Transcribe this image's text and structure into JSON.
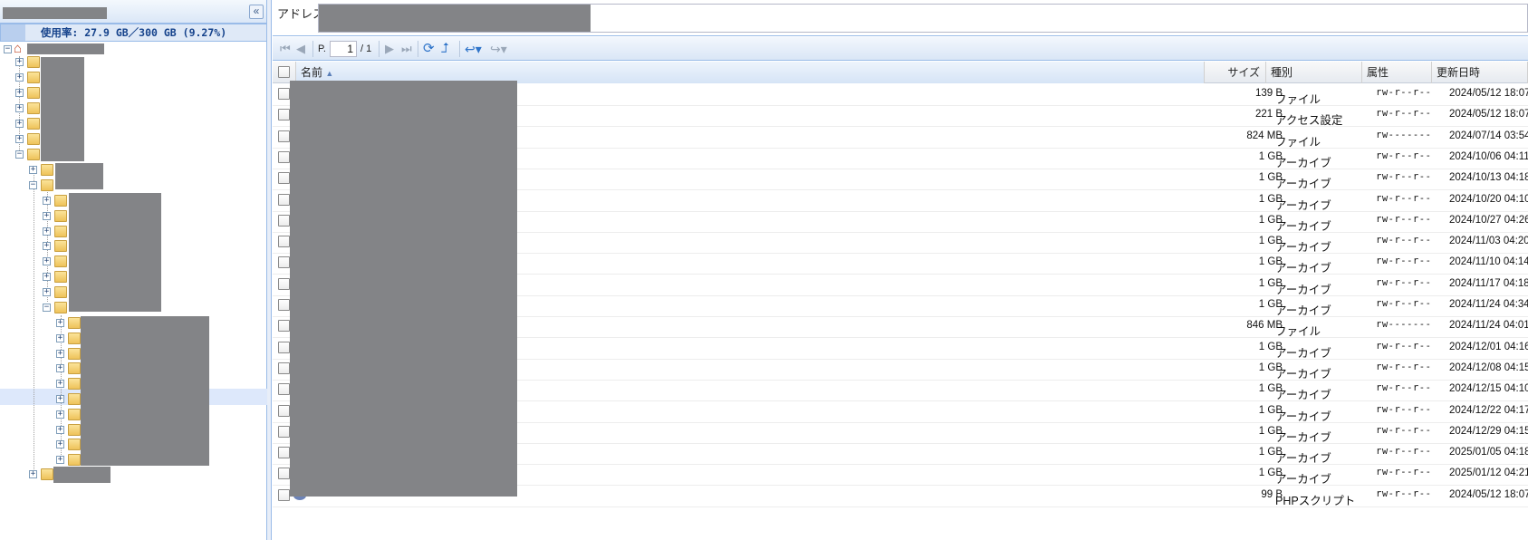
{
  "left_panel": {
    "collapse_label": "«",
    "usage_text": "使用率: 27.9 GB／300 GB (9.27%)",
    "usage_fraction": 0.0927
  },
  "address": {
    "label": "アドレス:"
  },
  "toolbar": {
    "page_prefix": "P.",
    "page_value": "1",
    "page_total": "/ 1"
  },
  "grid": {
    "headers": {
      "name": "名前",
      "size": "サイズ",
      "type": "種別",
      "attr": "属性",
      "date": "更新日時"
    },
    "rows": [
      {
        "icon": "file",
        "size": "139 B",
        "type": "ファイル",
        "attr": "rw-r--r--",
        "date": "2024/05/12 18:07"
      },
      {
        "icon": "htaccess",
        "size": "221 B",
        "type": "アクセス設定",
        "attr": "rw-r--r--",
        "date": "2024/05/12 18:07"
      },
      {
        "icon": "file",
        "size": "824 MB",
        "type": "ファイル",
        "attr": "rw-------",
        "date": "2024/07/14 03:54"
      },
      {
        "icon": "archive",
        "size": "1 GB",
        "type": "アーカイブ",
        "attr": "rw-r--r--",
        "date": "2024/10/06 04:11"
      },
      {
        "icon": "archive",
        "size": "1 GB",
        "type": "アーカイブ",
        "attr": "rw-r--r--",
        "date": "2024/10/13 04:18"
      },
      {
        "icon": "archive",
        "size": "1 GB",
        "type": "アーカイブ",
        "attr": "rw-r--r--",
        "date": "2024/10/20 04:10"
      },
      {
        "icon": "archive",
        "size": "1 GB",
        "type": "アーカイブ",
        "attr": "rw-r--r--",
        "date": "2024/10/27 04:26"
      },
      {
        "icon": "archive",
        "size": "1 GB",
        "type": "アーカイブ",
        "attr": "rw-r--r--",
        "date": "2024/11/03 04:20"
      },
      {
        "icon": "archive",
        "size": "1 GB",
        "type": "アーカイブ",
        "attr": "rw-r--r--",
        "date": "2024/11/10 04:14"
      },
      {
        "icon": "archive",
        "size": "1 GB",
        "type": "アーカイブ",
        "attr": "rw-r--r--",
        "date": "2024/11/17 04:18"
      },
      {
        "icon": "archive",
        "size": "1 GB",
        "type": "アーカイブ",
        "attr": "rw-r--r--",
        "date": "2024/11/24 04:34"
      },
      {
        "icon": "file",
        "size": "846 MB",
        "type": "ファイル",
        "attr": "rw-------",
        "date": "2024/11/24 04:01"
      },
      {
        "icon": "archive",
        "size": "1 GB",
        "type": "アーカイブ",
        "attr": "rw-r--r--",
        "date": "2024/12/01 04:16"
      },
      {
        "icon": "archive",
        "size": "1 GB",
        "type": "アーカイブ",
        "attr": "rw-r--r--",
        "date": "2024/12/08 04:15"
      },
      {
        "icon": "archive",
        "size": "1 GB",
        "type": "アーカイブ",
        "attr": "rw-r--r--",
        "date": "2024/12/15 04:10"
      },
      {
        "icon": "archive",
        "size": "1 GB",
        "type": "アーカイブ",
        "attr": "rw-r--r--",
        "date": "2024/12/22 04:17"
      },
      {
        "icon": "archive",
        "size": "1 GB",
        "type": "アーカイブ",
        "attr": "rw-r--r--",
        "date": "2024/12/29 04:15"
      },
      {
        "icon": "archive",
        "size": "1 GB",
        "type": "アーカイブ",
        "attr": "rw-r--r--",
        "date": "2025/01/05 04:18"
      },
      {
        "icon": "archive",
        "size": "1 GB",
        "type": "アーカイブ",
        "attr": "rw-r--r--",
        "date": "2025/01/12 04:21"
      },
      {
        "icon": "php",
        "size": "99 B",
        "type": "PHPスクリプト",
        "attr": "rw-r--r--",
        "date": "2024/05/12 18:07"
      }
    ]
  }
}
